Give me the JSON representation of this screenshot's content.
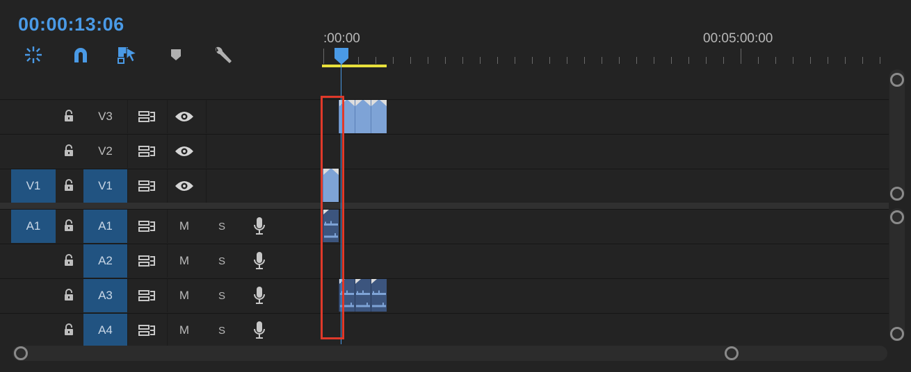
{
  "timecode": "00:00:13:06",
  "ruler": {
    "start_label": ":00:00",
    "end_label": "00:05:00:00"
  },
  "toolbar": {
    "items": [
      {
        "icon": "nest-sequence-icon"
      },
      {
        "icon": "snap-magnet-icon"
      },
      {
        "icon": "linked-selection-icon"
      },
      {
        "icon": "add-marker-icon"
      },
      {
        "icon": "wrench-settings-icon"
      }
    ]
  },
  "video_tracks": [
    {
      "source": "",
      "target": "V3",
      "target_on": false
    },
    {
      "source": "",
      "target": "V2",
      "target_on": false
    },
    {
      "source": "V1",
      "target": "V1",
      "target_on": true
    }
  ],
  "audio_tracks": [
    {
      "source": "A1",
      "target": "A1",
      "mute": "M",
      "solo": "S"
    },
    {
      "source": "",
      "target": "A2",
      "mute": "M",
      "solo": "S"
    },
    {
      "source": "",
      "target": "A3",
      "mute": "M",
      "solo": "S"
    },
    {
      "source": "",
      "target": "A4",
      "mute": "M",
      "solo": "S"
    }
  ],
  "colors": {
    "accent": "#4a9ae6",
    "target_fill": "#215381",
    "highlight": "#e0392a",
    "work_area": "#e8e03c"
  }
}
